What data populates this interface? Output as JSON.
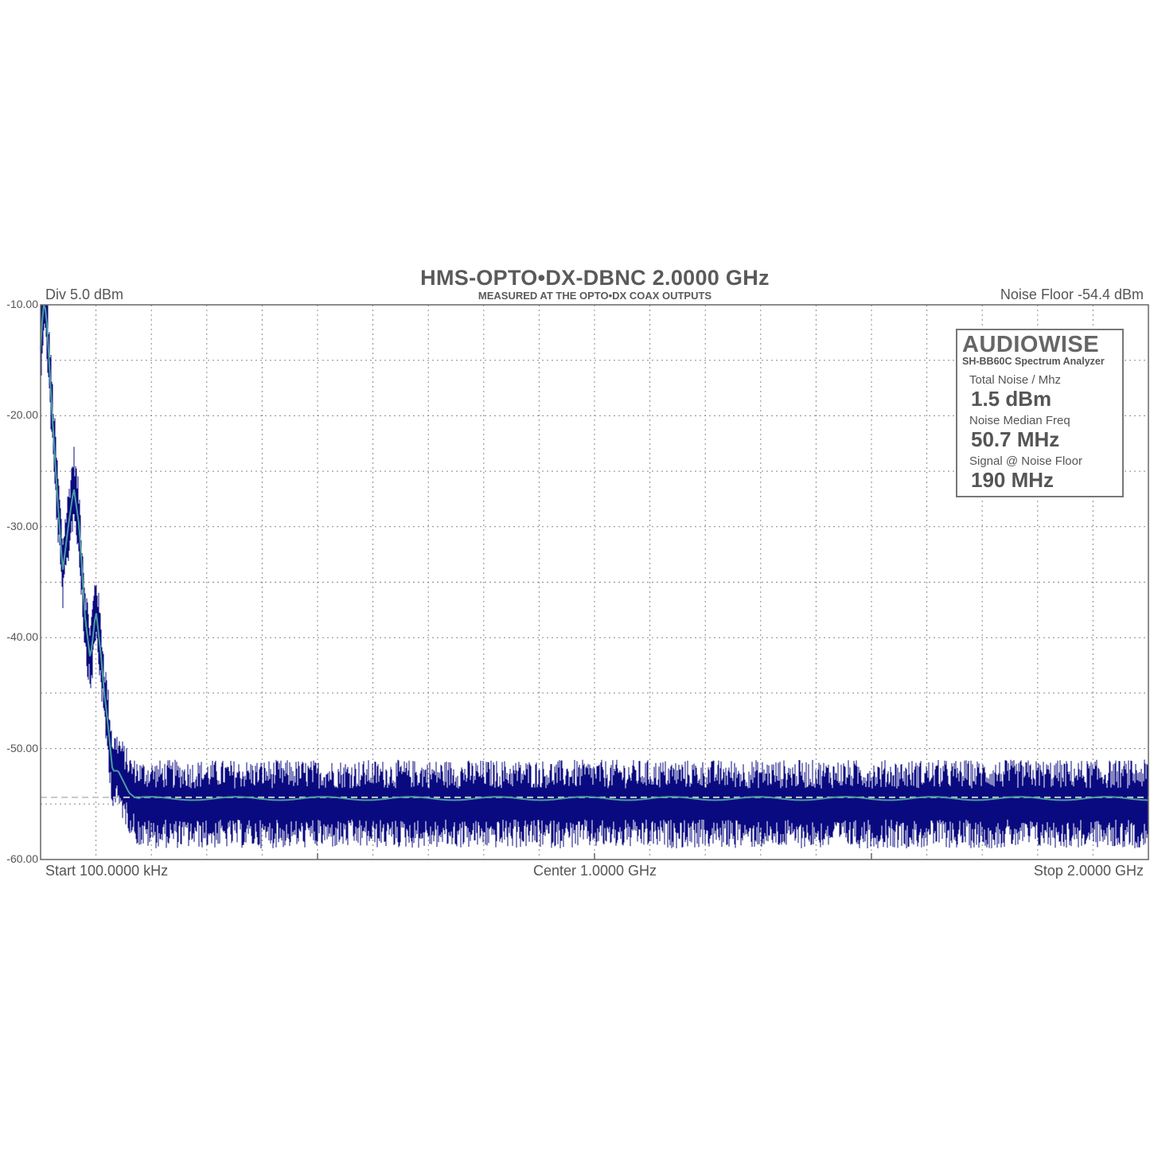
{
  "chart_data": {
    "type": "line",
    "title": "HMS-OPTO•DX-DBNC 2.0000 GHz",
    "subtitle": "MEASURED AT THE OPTO•DX COAX OUTPUTS",
    "div_label": "Div 5.0 dBm",
    "noise_floor_label": "Noise Floor -54.4 dBm",
    "x_start_label": "Start 100.0000 kHz",
    "x_center_label": "Center 1.0000 GHz",
    "x_stop_label": "Stop 2.0000 GHz",
    "xlim": [
      0.0001,
      2.0
    ],
    "ylim": [
      -60,
      -10
    ],
    "y_ticks": [
      "-10.00",
      "-20.00",
      "-30.00",
      "-40.00",
      "-50.00",
      "-60.00"
    ],
    "grid": true,
    "noise_floor_dbm": -54.4,
    "series": [
      {
        "x": [
          0.0001,
          0.006,
          0.012,
          0.02,
          0.03,
          0.04,
          0.05,
          0.06,
          0.07,
          0.08,
          0.09,
          0.1,
          0.11,
          0.115,
          0.12,
          0.13,
          0.14,
          0.15,
          0.16,
          0.17,
          0.18,
          0.19,
          0.3,
          0.5,
          0.7,
          0.9,
          1.1,
          1.3,
          1.5,
          1.7,
          1.9,
          2.0
        ],
        "values": [
          -14,
          -9,
          -12,
          -19,
          -27,
          -34,
          -30,
          -26.5,
          -30,
          -38,
          -42,
          -37.5,
          -42,
          -45,
          -47,
          -52,
          -52,
          -53,
          -54,
          -54.4,
          -54.5,
          -54.5,
          -54.5,
          -54.5,
          -54.5,
          -54.5,
          -54.5,
          -54.5,
          -54.5,
          -54.5,
          -54.5,
          -54.5
        ],
        "color": "#4a9e9e"
      },
      {
        "x": [
          0.0001,
          0.006,
          0.012,
          0.02,
          0.03,
          0.04,
          0.05,
          0.06,
          0.07,
          0.08,
          0.09,
          0.1,
          0.11,
          0.115,
          0.12,
          0.13,
          0.14,
          0.15,
          0.16,
          0.17,
          0.18,
          0.19,
          0.3,
          0.5,
          0.7,
          0.9,
          1.1,
          1.3,
          1.5,
          1.7,
          1.9,
          2.0
        ],
        "values": [
          -14,
          -9,
          -12,
          -19,
          -27,
          -34,
          -30,
          -26,
          -30,
          -38,
          -42,
          -37,
          -42,
          -45,
          -47,
          -52,
          -52,
          -53,
          -54,
          -54.5,
          -55,
          -55,
          -55,
          -55,
          -55,
          -55,
          -55,
          -55,
          -55,
          -55,
          -55,
          -55
        ],
        "noise_spread_db": 4,
        "color": "#0a0a80"
      }
    ]
  },
  "infobox": {
    "brand": "AUDIOWISE",
    "subtitle": "SH-BB60C Spectrum Analyzer",
    "metrics": [
      {
        "label": "Total Noise / Mhz",
        "value": "1.5 dBm"
      },
      {
        "label": "Noise Median Freq",
        "value": "50.7 MHz"
      },
      {
        "label": "Signal @ Noise Floor",
        "value": "190 MHz"
      }
    ]
  }
}
